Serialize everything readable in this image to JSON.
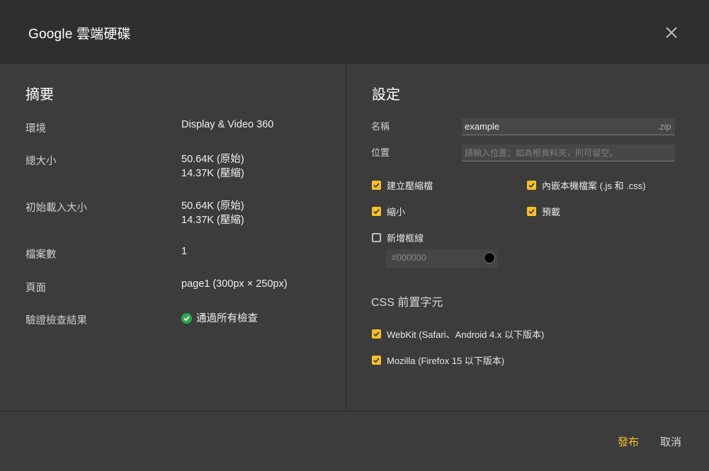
{
  "header": {
    "title": "Google 雲端硬碟"
  },
  "summary": {
    "title": "摘要",
    "rows": [
      {
        "label": "環境",
        "value": "Display & Video 360"
      },
      {
        "label": "總大小",
        "value": "50.64K (原始)",
        "value2": "14.37K (壓縮)"
      },
      {
        "label": "初始載入大小",
        "value": "50.64K (原始)",
        "value2": "14.37K (壓縮)"
      },
      {
        "label": "檔案數",
        "value": "1"
      },
      {
        "label": "頁面",
        "value": "page1 (300px × 250px)"
      },
      {
        "label": "驗證檢查結果",
        "value": "通過所有檢查"
      }
    ]
  },
  "settings": {
    "title": "設定",
    "name_label": "名稱",
    "name_value": "example",
    "name_suffix": ".zip",
    "location_label": "位置",
    "location_placeholder": "請輸入位置；如為根資料夾，則可留空。",
    "options": [
      {
        "label": "建立壓縮檔",
        "checked": true
      },
      {
        "label": "內嵌本機檔案 (.js 和 .css)",
        "checked": true
      },
      {
        "label": "縮小",
        "checked": true
      },
      {
        "label": "預載",
        "checked": true
      },
      {
        "label": "新增框線",
        "checked": false
      }
    ],
    "border_color": "#000000",
    "css_prefix_title": "CSS 前置字元",
    "css_options": [
      {
        "label": "WebKit (Safari、Android 4.x 以下版本)",
        "checked": true
      },
      {
        "label": "Mozilla (Firefox 15 以下版本)",
        "checked": true
      }
    ]
  },
  "footer": {
    "publish_label": "發布",
    "cancel_label": "取消"
  },
  "colors": {
    "accent": "#f6c027",
    "success": "#2fa84f",
    "background": "#3c3c3c",
    "header": "#2f2f2f"
  }
}
